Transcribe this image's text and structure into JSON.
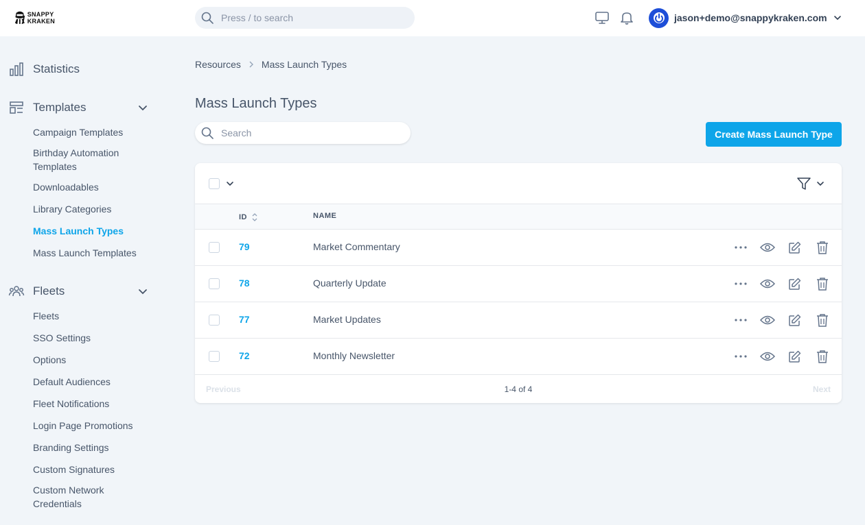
{
  "app": {
    "logo_line1": "SNAPPY",
    "logo_line2": "KRAKEN"
  },
  "topbar": {
    "search_placeholder": "Press / to search",
    "user_email": "jason+demo@snappykraken.com"
  },
  "sidebar": {
    "statistics": "Statistics",
    "templates": {
      "label": "Templates",
      "items": [
        "Campaign Templates",
        "Birthday Automation Templates",
        "Downloadables",
        "Library Categories",
        "Mass Launch Types",
        "Mass Launch Templates"
      ]
    },
    "fleets": {
      "label": "Fleets",
      "items": [
        "Fleets",
        "SSO Settings",
        "Options",
        "Default Audiences",
        "Fleet Notifications",
        "Login Page Promotions",
        "Branding Settings",
        "Custom Signatures",
        "Custom Network Credentials"
      ]
    }
  },
  "breadcrumb": {
    "parent": "Resources",
    "current": "Mass Launch Types"
  },
  "page": {
    "title": "Mass Launch Types",
    "search_placeholder": "Search",
    "create_button": "Create Mass Launch Type"
  },
  "table": {
    "columns": {
      "id": "ID",
      "name": "NAME"
    },
    "rows": [
      {
        "id": "79",
        "name": "Market Commentary"
      },
      {
        "id": "78",
        "name": "Quarterly Update"
      },
      {
        "id": "77",
        "name": "Market Updates"
      },
      {
        "id": "72",
        "name": "Monthly Newsletter"
      }
    ]
  },
  "pagination": {
    "previous": "Previous",
    "info": "1-4 of 4",
    "next": "Next"
  },
  "colors": {
    "accent": "#0ea5e9",
    "avatar": "#1d4ed8",
    "background": "#f1f5f9"
  }
}
